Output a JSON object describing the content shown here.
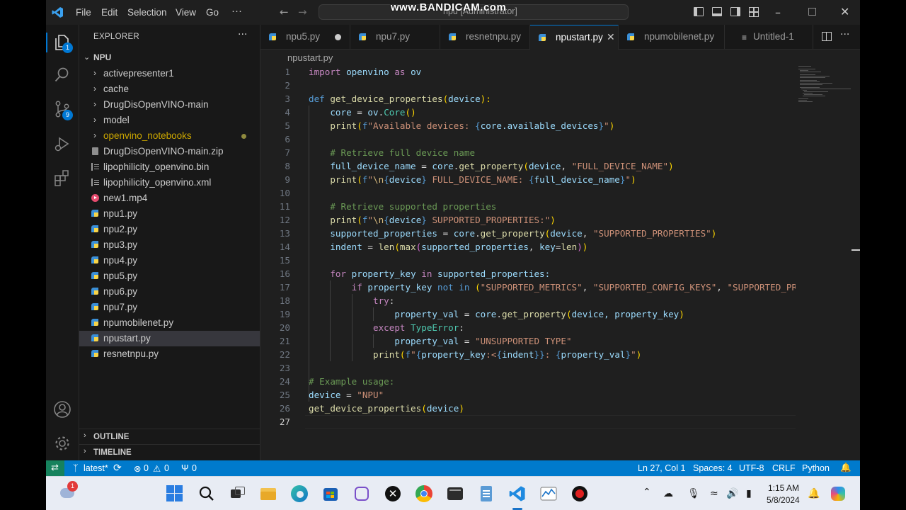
{
  "titlebar": {
    "menu": [
      "File",
      "Edit",
      "Selection",
      "View",
      "Go",
      "···"
    ],
    "search_text": "npu [Administrator]",
    "watermark": "www.BANDICAM.com"
  },
  "activity": {
    "explorer_badge": "1",
    "scm_badge": "9"
  },
  "explorer": {
    "title": "EXPLORER",
    "more": "···",
    "folder_name": "NPU",
    "items": [
      {
        "label": "activepresenter1",
        "type": "folder"
      },
      {
        "label": "cache",
        "type": "folder"
      },
      {
        "label": "DrugDisOpenVINO-main",
        "type": "folder"
      },
      {
        "label": "model",
        "type": "folder"
      },
      {
        "label": "openvino_notebooks",
        "type": "folder"
      },
      {
        "label": "DrugDisOpenVINO-main.zip",
        "type": "zip"
      },
      {
        "label": "lipophilicity_openvino.bin",
        "type": "bin"
      },
      {
        "label": "lipophilicity_openvino.xml",
        "type": "xml"
      },
      {
        "label": "new1.mp4",
        "type": "mp4"
      },
      {
        "label": "npu1.py",
        "type": "py"
      },
      {
        "label": "npu2.py",
        "type": "py"
      },
      {
        "label": "npu3.py",
        "type": "py"
      },
      {
        "label": "npu4.py",
        "type": "py"
      },
      {
        "label": "npu5.py",
        "type": "py"
      },
      {
        "label": "npu6.py",
        "type": "py"
      },
      {
        "label": "npu7.py",
        "type": "py"
      },
      {
        "label": "npumobilenet.py",
        "type": "py"
      },
      {
        "label": "npustart.py",
        "type": "py"
      },
      {
        "label": "resnetnpu.py",
        "type": "py"
      }
    ],
    "outline": "OUTLINE",
    "timeline": "TIMELINE"
  },
  "tabs": [
    {
      "label": "npu5.py"
    },
    {
      "label": "npu7.py"
    },
    {
      "label": "resnetnpu.py"
    },
    {
      "label": "npustart.py"
    },
    {
      "label": "npumobilenet.py"
    },
    {
      "label": "Untitled-1"
    }
  ],
  "breadcrumb": "npustart.py",
  "editor": {
    "line_numbers": [
      "1",
      "2",
      "3",
      "4",
      "5",
      "6",
      "7",
      "8",
      "9",
      "10",
      "11",
      "12",
      "13",
      "14",
      "15",
      "16",
      "17",
      "18",
      "19",
      "20",
      "21",
      "22",
      "23",
      "24",
      "25",
      "26",
      "27"
    ],
    "code": {
      "l1_kw": "import",
      "l1_mod": " openvino ",
      "l1_as": "as",
      "l1_alias": " ov",
      "l3_def": "def",
      "l3_fn": " get_device_properties",
      "l3_p1": "(",
      "l3_param": "device",
      "l3_p2": "):",
      "l4_var": "    core",
      "l4_eq": " = ",
      "l4_mod": "ov",
      "l4_dot": ".",
      "l4_cls": "Core",
      "l4_paren": "()",
      "l5_fn": "    print",
      "l5_p1": "(",
      "l5_f": "f",
      "l5_str": "\"Available devices: ",
      "l5_b1": "{",
      "l5_expr": "core.available_devices",
      "l5_b2": "}",
      "l5_end": "\"",
      "l5_p2": ")",
      "l7_cm": "    # Retrieve full device name",
      "l8_var": "    full_device_name",
      "l8_eq": " = ",
      "l8_obj": "core",
      "l8_dot": ".",
      "l8_fn": "get_property",
      "l8_p1": "(",
      "l8_arg": "device",
      "l8_comma": ", ",
      "l8_str": "\"FULL_DEVICE_NAME\"",
      "l8_p2": ")",
      "l9_fn": "    print",
      "l9_p1": "(",
      "l9_f": "f",
      "l9_q": "\"",
      "l9_esc": "\\n",
      "l9_b1": "{",
      "l9_expr": "device",
      "l9_b2": "}",
      "l9_str": " FULL_DEVICE_NAME: ",
      "l9_b3": "{",
      "l9_expr2": "full_device_name",
      "l9_b4": "}",
      "l9_end": "\"",
      "l9_p2": ")",
      "l11_cm": "    # Retrieve supported properties",
      "l12_fn": "    print",
      "l12_p1": "(",
      "l12_f": "f",
      "l12_q": "\"",
      "l12_esc": "\\n",
      "l12_b1": "{",
      "l12_expr": "device",
      "l12_b2": "}",
      "l12_str": " SUPPORTED_PROPERTIES:\"",
      "l12_p2": ")",
      "l13_var": "    supported_properties",
      "l13_eq": " = ",
      "l13_obj": "core",
      "l13_dot": ".",
      "l13_fn": "get_property",
      "l13_p1": "(",
      "l13_arg": "device",
      "l13_comma": ", ",
      "l13_str": "\"SUPPORTED_PROPERTIES\"",
      "l13_p2": ")",
      "l14_var": "    indent",
      "l14_eq": " = ",
      "l14_fn": "len",
      "l14_p1": "(",
      "l14_fn2": "max",
      "l14_p2": "(",
      "l14_arg": "supported_properties",
      "l14_comma": ", ",
      "l14_kw": "key",
      "l14_eq2": "=",
      "l14_fn3": "len",
      "l14_p3": ")",
      "l14_p4": ")",
      "l16_kw": "    for",
      "l16_var": " property_key ",
      "l16_in": "in",
      "l16_var2": " supported_properties:",
      "l17_kw": "        if",
      "l17_var": " property_key ",
      "l17_op": "not in",
      "l17_p1": " (",
      "l17_s1": "\"SUPPORTED_METRICS\"",
      "l17_c1": ", ",
      "l17_s2": "\"SUPPORTED_CONFIG_KEYS\"",
      "l17_c2": ", ",
      "l17_s3": "\"SUPPORTED_PROPERTIES\"):",
      "l18_kw": "            try",
      "l18_colon": ":",
      "l19_var": "                property_val",
      "l19_eq": " = ",
      "l19_obj": "core",
      "l19_dot": ".",
      "l19_fn": "get_property",
      "l19_p1": "(",
      "l19_args": "device, property_key",
      "l19_p2": ")",
      "l20_kw": "            except",
      "l20_cls": " TypeError",
      "l20_colon": ":",
      "l21_var": "                property_val",
      "l21_eq": " = ",
      "l21_str": "\"UNSUPPORTED TYPE\"",
      "l22_fn": "            print",
      "l22_p1": "(",
      "l22_f": "f",
      "l22_q": "\"",
      "l22_b1": "{",
      "l22_expr": "property_key",
      "l22_fmt": ":<",
      "l22_b2": "{",
      "l22_expr2": "indent",
      "l22_b3": "}",
      "l22_b4": "}",
      "l22_str": ": ",
      "l22_b5": "{",
      "l22_expr3": "property_val",
      "l22_b6": "}",
      "l22_end": "\"",
      "l22_p2": ")",
      "l24_cm": "# Example usage:",
      "l25_var": "device",
      "l25_eq": " = ",
      "l25_str": "\"NPU\"",
      "l26_fn": "get_device_properties",
      "l26_p1": "(",
      "l26_arg": "device",
      "l26_p2": ")"
    }
  },
  "statusbar": {
    "branch": "latest*",
    "errors": "0",
    "warnings": "0",
    "ports": "0",
    "position": "Ln 27, Col 1",
    "spaces": "Spaces: 4",
    "encoding": "UTF-8",
    "eol": "CRLF",
    "language": "Python"
  },
  "taskbar": {
    "weather_badge": "1",
    "time": "1:15 AM",
    "date": "5/8/2024"
  },
  "colors": {
    "accent": "#007acc",
    "remote": "#16825d"
  }
}
